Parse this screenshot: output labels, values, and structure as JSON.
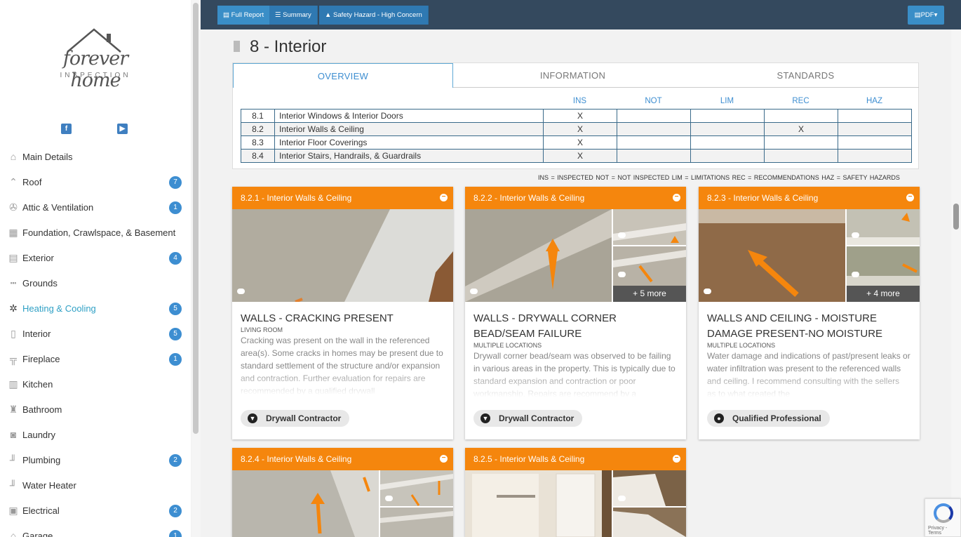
{
  "logo": {
    "main": "forever home",
    "sub": "INSPECTION"
  },
  "social": [
    {
      "icon": "facebook-icon",
      "glyph": "f"
    },
    {
      "icon": "youtube-icon",
      "glyph": "▶"
    }
  ],
  "nav": [
    {
      "label": "Main Details",
      "icon": "home-icon",
      "glyph": "⌂",
      "badge": ""
    },
    {
      "label": "Roof",
      "icon": "roof-icon",
      "glyph": "⌃",
      "badge": "7"
    },
    {
      "label": "Attic & Ventilation",
      "icon": "fan-icon",
      "glyph": "✇",
      "badge": "1"
    },
    {
      "label": "Foundation, Crawlspace, & Basement",
      "icon": "bricks-icon",
      "glyph": "▦",
      "badge": ""
    },
    {
      "label": "Exterior",
      "icon": "house-siding-icon",
      "glyph": "▤",
      "badge": "4"
    },
    {
      "label": "Grounds",
      "icon": "fence-icon",
      "glyph": "┅",
      "badge": ""
    },
    {
      "label": "Heating & Cooling",
      "icon": "snowflake-icon",
      "glyph": "✲",
      "badge": "5",
      "active": true
    },
    {
      "label": "Interior",
      "icon": "door-icon",
      "glyph": "▯",
      "badge": "5"
    },
    {
      "label": "Fireplace",
      "icon": "fireplace-icon",
      "glyph": "╦",
      "badge": "1"
    },
    {
      "label": "Kitchen",
      "icon": "fridge-icon",
      "glyph": "▥",
      "badge": ""
    },
    {
      "label": "Bathroom",
      "icon": "toilet-icon",
      "glyph": "♜",
      "badge": ""
    },
    {
      "label": "Laundry",
      "icon": "washer-icon",
      "glyph": "◙",
      "badge": ""
    },
    {
      "label": "Plumbing",
      "icon": "pipe-icon",
      "glyph": "╜",
      "badge": "2"
    },
    {
      "label": "Water Heater",
      "icon": "water-heater-icon",
      "glyph": "╜",
      "badge": ""
    },
    {
      "label": "Electrical",
      "icon": "electrical-panel-icon",
      "glyph": "▣",
      "badge": "2"
    },
    {
      "label": "Garage",
      "icon": "garage-icon",
      "glyph": "⌂",
      "badge": "1"
    }
  ],
  "topbar": {
    "full_report": "Full Report",
    "summary": "Summary",
    "safety": "Safety Hazard - High Concern",
    "pdf": "PDF"
  },
  "section": {
    "title": "8 - Interior"
  },
  "tabs": [
    "OVERVIEW",
    "INFORMATION",
    "STANDARDS"
  ],
  "columns": [
    "INS",
    "NOT",
    "LIM",
    "REC",
    "HAZ"
  ],
  "rows": [
    {
      "num": "8.1",
      "name": "Interior Windows & Interior Doors",
      "ins": "X",
      "not": "",
      "lim": "",
      "rec": "",
      "haz": ""
    },
    {
      "num": "8.2",
      "name": "Interior Walls & Ceiling",
      "ins": "X",
      "not": "",
      "lim": "",
      "rec": "X",
      "haz": ""
    },
    {
      "num": "8.3",
      "name": "Interior Floor Coverings",
      "ins": "X",
      "not": "",
      "lim": "",
      "rec": "",
      "haz": ""
    },
    {
      "num": "8.4",
      "name": "Interior Stairs, Handrails, & Guardrails",
      "ins": "X",
      "not": "",
      "lim": "",
      "rec": "",
      "haz": ""
    }
  ],
  "legend": "INS = INSPECTED   NOT = NOT INSPECTED   LIM = LIMITATIONS   REC = RECOMMENDATIONS   HAZ = SAFETY HAZARDS",
  "cards": [
    {
      "header": "8.2.1 - Interior Walls & Ceiling",
      "title": "WALLS - CRACKING PRESENT",
      "location": "LIVING ROOM",
      "desc": "Cracking was present on the wall in the referenced area(s). Some cracks in homes may be present due to standard settlement of the structure and/or expansion and contraction. Further evaluation for repairs are recommended by a qualified drywall",
      "chip": "Drywall Contractor",
      "chip_icon": "trowel-icon",
      "more": ""
    },
    {
      "header": "8.2.2 - Interior Walls & Ceiling",
      "title": "WALLS - DRYWALL CORNER BEAD/SEAM FAILURE",
      "location": "MULTIPLE LOCATIONS",
      "desc": "Drywall corner bead/seam was observed to be failing in various areas in the property. This is typically due to standard expansion and contraction or poor workmanship. Repairs are recommend by a",
      "chip": "Drywall Contractor",
      "chip_icon": "trowel-icon",
      "more": "+ 5 more"
    },
    {
      "header": "8.2.3 - Interior Walls & Ceiling",
      "title": "WALLS AND CEILING - MOISTURE DAMAGE PRESENT-NO MOISTURE",
      "location": "MULTIPLE LOCATIONS",
      "desc": "Water damage and indications of past/present leaks or water infiltration was present to the referenced walls and ceiling. I recommend consulting with the sellers as to what created the",
      "chip": "Qualified Professional",
      "chip_icon": "person-icon",
      "more": "+ 4 more"
    },
    {
      "header": "8.2.4 - Interior Walls & Ceiling"
    },
    {
      "header": "8.2.5 - Interior Walls & Ceiling"
    }
  ],
  "recaptcha": "Privacy - Terms",
  "colors": {
    "orange": "#f5860d",
    "blue": "#3d8ed1",
    "topbar": "#34495e"
  }
}
